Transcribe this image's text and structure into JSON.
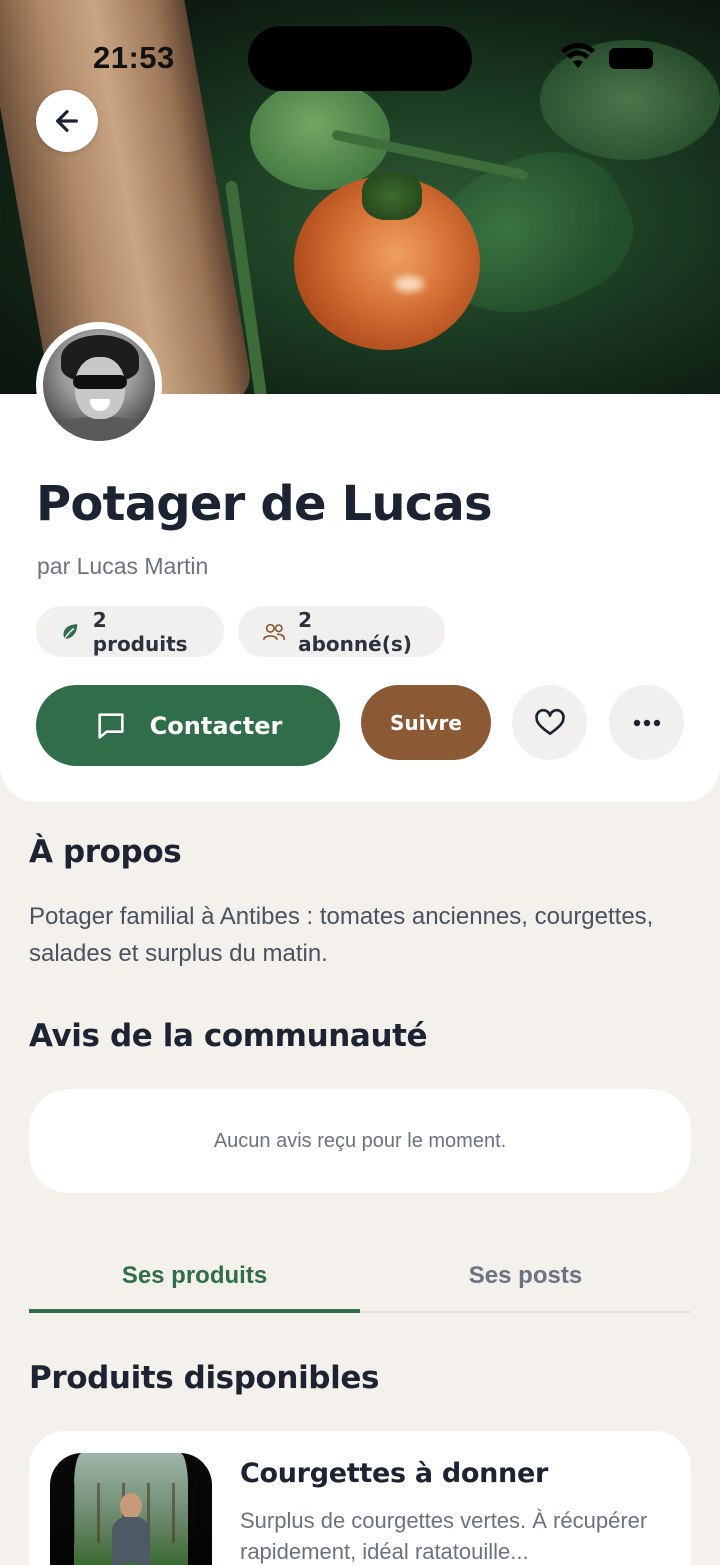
{
  "status_bar": {
    "time": "21:53"
  },
  "profile": {
    "title": "Potager de Lucas",
    "byline": "par Lucas Martin",
    "products_chip": "2 produits",
    "followers_chip": "2 abonné(s)"
  },
  "actions": {
    "contact_label": "Contacter",
    "follow_label": "Suivre"
  },
  "about": {
    "title": "À propos",
    "text": "Potager familial à Antibes : tomates anciennes, courgettes, salades et surplus du matin."
  },
  "reviews": {
    "title": "Avis de la communauté",
    "empty_text": "Aucun avis reçu pour le moment."
  },
  "tabs": [
    {
      "label": "Ses produits",
      "active": true
    },
    {
      "label": "Ses posts",
      "active": false
    }
  ],
  "products": {
    "title": "Produits disponibles",
    "items": [
      {
        "name": "Courgettes à donner",
        "description": "Surplus de courgettes vertes. À récupérer rapidement, idéal ratatouille..."
      }
    ]
  },
  "colors": {
    "primary_green": "#2f6e49",
    "follow_brown": "#8b5a35",
    "background": "#f4f1ec"
  },
  "icons": [
    "arrow-left-icon",
    "leaf-icon",
    "users-icon",
    "message-square-icon",
    "heart-icon",
    "more-horizontal-icon"
  ]
}
